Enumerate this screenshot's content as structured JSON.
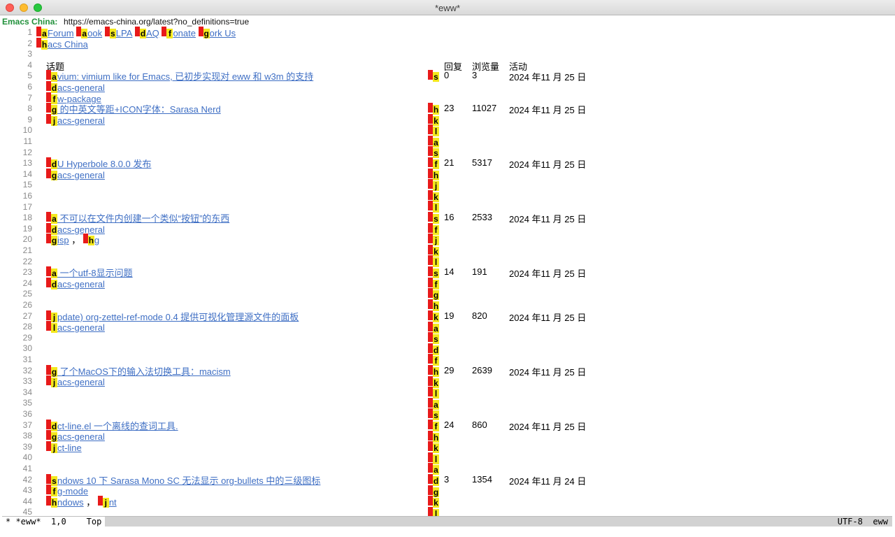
{
  "window": {
    "title": "*eww*"
  },
  "header": {
    "site": "Emacs China",
    "colon": ":",
    "url": "https://emacs-china.org/latest?no_definitions=true"
  },
  "line_numbers": [
    "1",
    "2",
    "3",
    "4",
    "5",
    "6",
    "7",
    "8",
    "9",
    "10",
    "11",
    "12",
    "13",
    "14",
    "15",
    "16",
    "17",
    "18",
    "19",
    "20",
    "21",
    "22",
    "23",
    "24",
    "25",
    "26",
    "27",
    "28",
    "29",
    "30",
    "31",
    "32",
    "33",
    "34",
    "35",
    "36",
    "37",
    "38",
    "39",
    "40",
    "41",
    "42",
    "43",
    "44",
    "45"
  ],
  "nav": [
    {
      "hint": "a",
      "label": "Forum"
    },
    {
      "hint": "a",
      "label": "ook"
    },
    {
      "hint": "s",
      "label": "LPA"
    },
    {
      "hint": "d",
      "label": "AQ"
    },
    {
      "hint": "f",
      "label": "onate"
    },
    {
      "hint": "g",
      "label": "ork Us"
    }
  ],
  "home": {
    "hint": "h",
    "label": "acs China"
  },
  "columns": {
    "topic": "话题",
    "replies": "回复",
    "views": "浏览量",
    "activity": "活动"
  },
  "topics": [
    {
      "title_hint": "a",
      "title": "vium: vimium like for Emacs, 已初步实现对 eww 和 w3m 的支持",
      "replies": "0",
      "views": "3",
      "activity": "2024 年11 月 25 日",
      "subs": [
        {
          "hint": "d",
          "label": "acs-general "
        },
        {
          "hint": "f",
          "label": "w-package"
        }
      ],
      "right_hints": [
        "s"
      ]
    },
    {
      "title_hint": "g",
      "title": " 的中英文等距+ICON字体：Sarasa Nerd",
      "replies": "23",
      "views": "11027",
      "activity": "2024 年11 月 25 日",
      "subs": [
        {
          "hint": "j",
          "label": "acs-general "
        }
      ],
      "right_hints": [
        "h",
        "k",
        "l",
        "a",
        "s"
      ]
    },
    {
      "title_hint": "d",
      "title": "U Hyperbole 8.0.0 发布",
      "replies": "21",
      "views": "5317",
      "activity": "2024 年11 月 25 日",
      "subs": [
        {
          "hint": "g",
          "label": "acs-general "
        }
      ],
      "right_hints": [
        "f",
        "h",
        "j",
        "k",
        "l"
      ]
    },
    {
      "title_hint": "a",
      "title": " 不可以在文件内创建一个类似“按钮”的东西",
      "replies": "16",
      "views": "2533",
      "activity": "2024 年11 月 25 日",
      "subs": [
        {
          "hint": "d",
          "label": "acs-general "
        },
        {
          "hint": "g",
          "label": "isp"
        }
      ],
      "extra_sub": {
        "hint": "h",
        "label": "g",
        "sep": "，"
      },
      "right_hints": [
        "s",
        "f",
        "j",
        "k",
        "l"
      ]
    },
    {
      "title_hint": "a",
      "title": " 一个utf-8显示问题",
      "replies": "14",
      "views": "191",
      "activity": "2024 年11 月 25 日",
      "subs": [
        {
          "hint": "d",
          "label": "acs-general "
        }
      ],
      "right_hints": [
        "s",
        "f",
        "g",
        "h"
      ]
    },
    {
      "title_hint": "j",
      "title": "pdate) org-zettel-ref-mode 0.4 提供可视化管理源文件的面板",
      "replies": "19",
      "views": "820",
      "activity": "2024 年11 月 25 日",
      "subs": [
        {
          "hint": "l",
          "label": "acs-general "
        }
      ],
      "right_hints": [
        "k",
        "a",
        "s",
        "d",
        "f"
      ]
    },
    {
      "title_hint": "g",
      "title": " 了个MacOS下的输入法切换工具：macism",
      "replies": "29",
      "views": "2639",
      "activity": "2024 年11 月 25 日",
      "subs": [
        {
          "hint": "j",
          "label": "acs-general "
        }
      ],
      "right_hints": [
        "h",
        "k",
        "l",
        "a",
        "s"
      ]
    },
    {
      "title_hint": "d",
      "title": "ct-line.el 一个离线的查词工具.",
      "replies": "24",
      "views": "860",
      "activity": "2024 年11 月 25 日",
      "subs": [
        {
          "hint": "g",
          "label": "acs-general "
        },
        {
          "hint": "j",
          "label": "ct-line"
        }
      ],
      "right_hints": [
        "f",
        "h",
        "k",
        "l",
        "a"
      ]
    },
    {
      "title_hint": "s",
      "title": "ndows 10 下 Sarasa Mono SC 无法显示 org-bullets 中的三级图标",
      "replies": "3",
      "views": "1354",
      "activity": "2024 年11 月 24 日",
      "subs": [
        {
          "hint": "f",
          "label": "g-mode "
        },
        {
          "hint": "h",
          "label": "ndows"
        }
      ],
      "extra_sub": {
        "hint": "j",
        "label": "nt",
        "sep": "，"
      },
      "right_hints": [
        "d",
        "g",
        "k",
        "l"
      ]
    }
  ],
  "modeline": {
    "left": "* *eww*",
    "position": "1,0",
    "scroll": "Top",
    "encoding": "UTF-8",
    "mode": "eww"
  },
  "colors": {
    "link": "#3f6fc4",
    "hint_red": "#e81a1a",
    "hint_yellow": "#f4e81c",
    "header_green": "#21913b"
  }
}
